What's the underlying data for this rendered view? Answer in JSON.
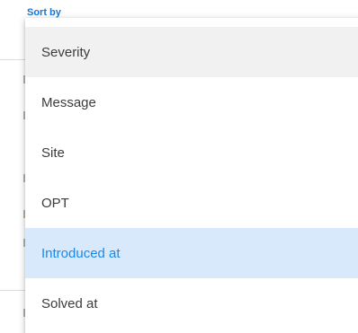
{
  "sort": {
    "label": "Sort by"
  },
  "menu": {
    "items": [
      {
        "label": "Severity",
        "state": "hover"
      },
      {
        "label": "Message",
        "state": "normal"
      },
      {
        "label": "Site",
        "state": "normal"
      },
      {
        "label": "OPT",
        "state": "normal"
      },
      {
        "label": "Introduced at",
        "state": "selected"
      },
      {
        "label": "Solved at",
        "state": "normal"
      }
    ],
    "selected_index": 4
  },
  "colors": {
    "accent": "#1976d2",
    "selected_bg": "#d7e9fb",
    "selected_text": "#1e88e5",
    "hover_bg": "#f1f1f1",
    "text": "#3b3b3b"
  }
}
